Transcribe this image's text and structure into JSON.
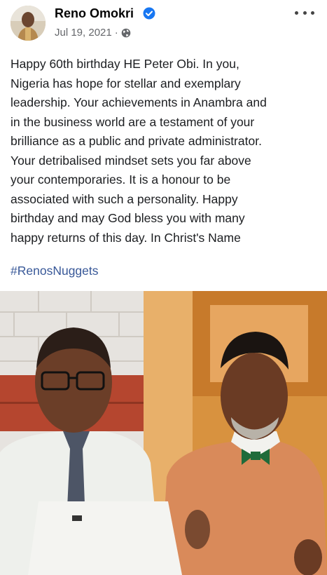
{
  "post": {
    "author": "Reno Omokri",
    "date": "Jul 19, 2021",
    "separator": "·",
    "body": "Happy 60th birthday HE Peter Obi. In you,\nNigeria has hope for stellar and exemplary\nleadership. Your achievements in Anambra and\nin the business world are a testament of your\nbrilliance as a public and private administrator.\nYour detribalised mindset sets you far above\nyour contemporaries. It is a honour to be\nassociated with such a personality. Happy\nbirthday and may God bless you with many\nhappy returns of this day. In Christ's Name",
    "hashtag": "#RenosNuggets"
  },
  "icons": {
    "verified": "verified-badge-icon",
    "privacy": "globe-icon",
    "more": "more-options-icon"
  },
  "colors": {
    "verified": "#1877f2",
    "hashtag": "#385898",
    "meta": "#65676b"
  }
}
